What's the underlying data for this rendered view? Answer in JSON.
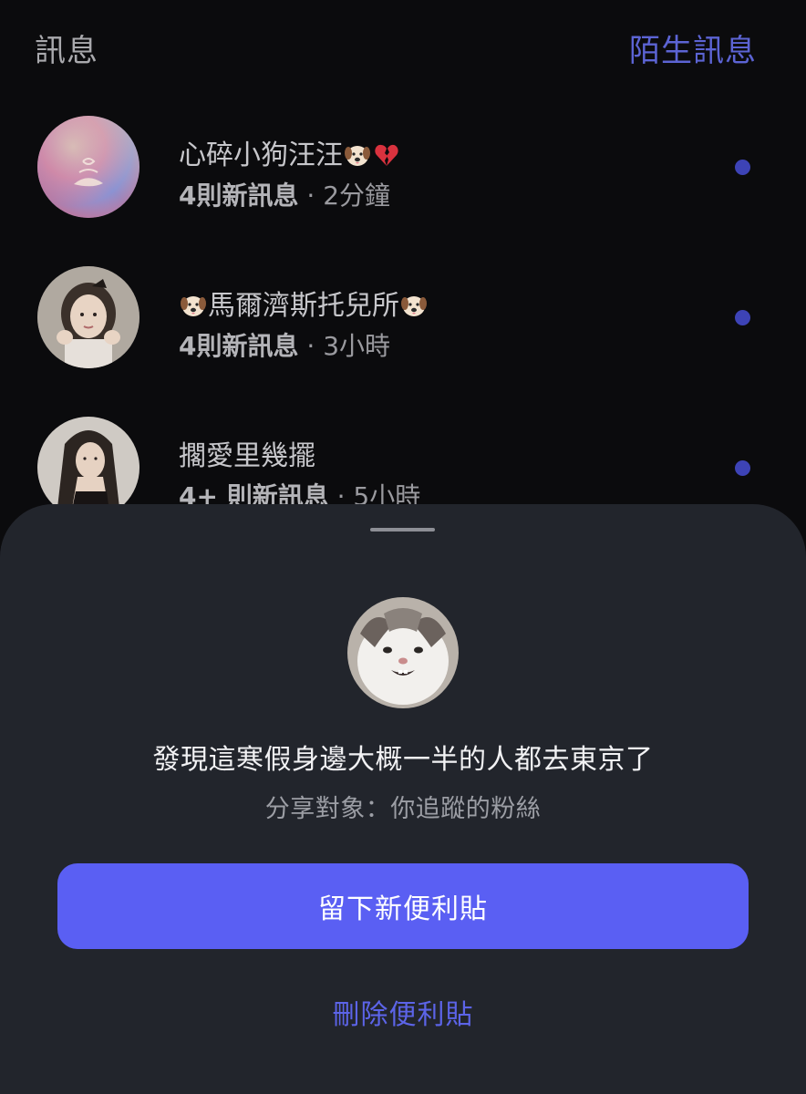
{
  "header": {
    "title": "訊息",
    "requests_link": "陌生訊息"
  },
  "messages": [
    {
      "name_text": "心碎小狗汪汪",
      "name_suffix_emojis": [
        "dog-face",
        "broken-heart"
      ],
      "new_count": "4則新訊息",
      "separator": " · ",
      "time": "2分鐘",
      "unread": true
    },
    {
      "name_prefix_emoji": "dog-face",
      "name_text": "馬爾濟斯托兒所",
      "name_suffix_emojis": [
        "dog-face"
      ],
      "new_count": "4則新訊息",
      "separator": " · ",
      "time": "3小時",
      "unread": true
    },
    {
      "name_text": "擱愛里幾擺",
      "new_count": "4+ 則新訊息",
      "separator": " · ",
      "time": "5小時",
      "unread": true
    }
  ],
  "sheet": {
    "note_text": "發現這寒假身邊大概一半的人都去東京了",
    "audience_text": "分享對象：你追蹤的粉絲",
    "primary_button": "留下新便利貼",
    "secondary_button": "刪除便利貼"
  },
  "colors": {
    "background": "#0b0b0d",
    "sheet": "#22252c",
    "accent": "#5a5ff3",
    "link": "#5c64d4",
    "unread_dot": "#3d43b6"
  }
}
